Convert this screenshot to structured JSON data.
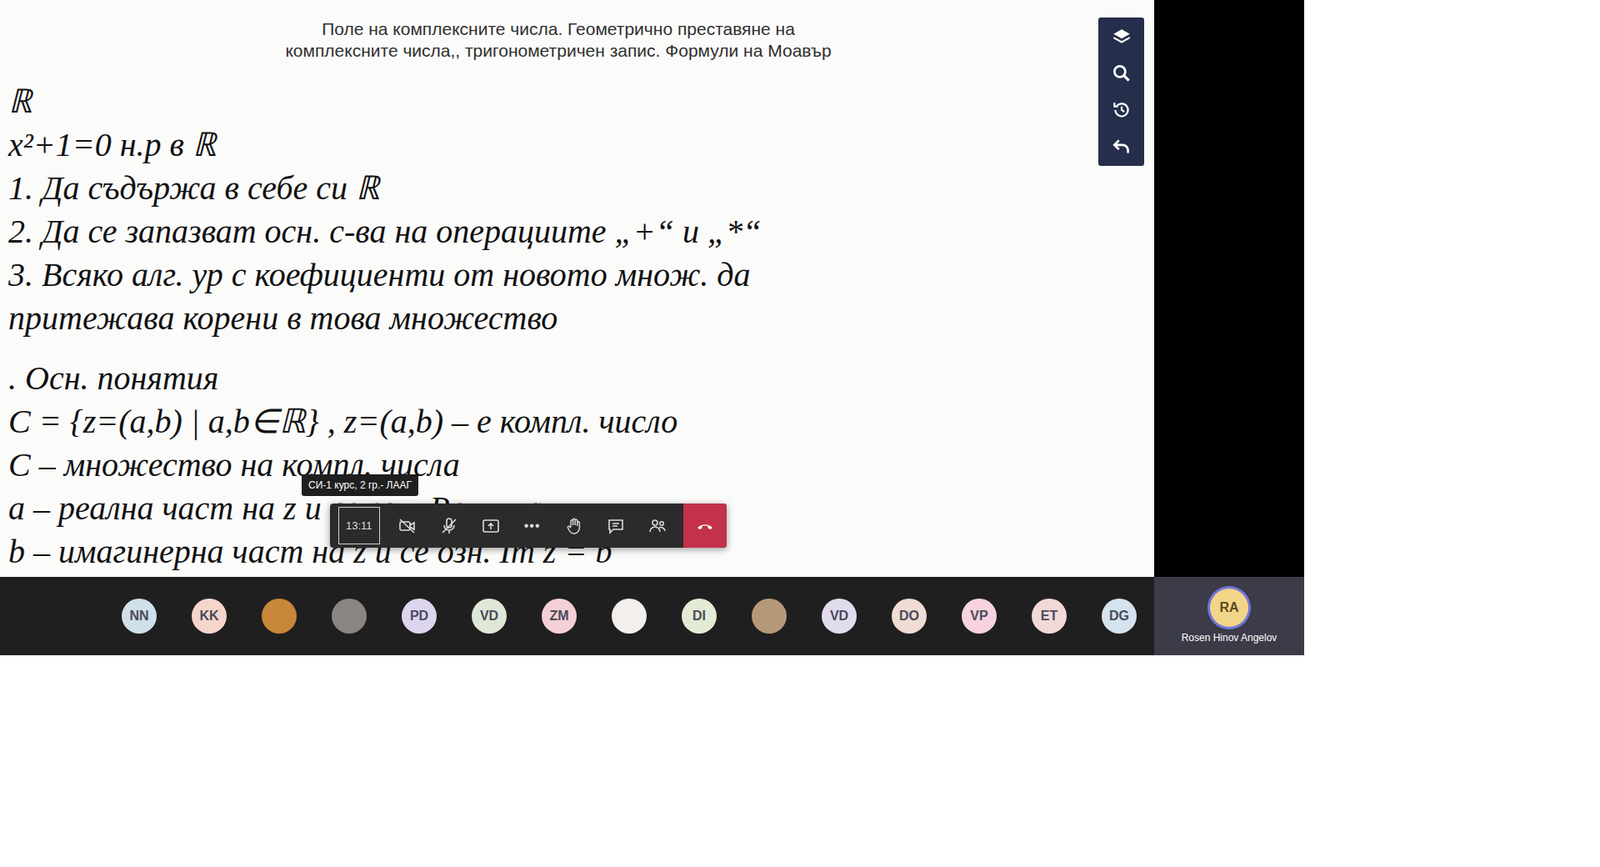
{
  "whiteboard": {
    "title": [
      "Поле на комплексните числа. Геометрично преставяне на",
      "комплексните числа,, тригонометричен запис. Формули на Моавър"
    ],
    "intro_lines": [
      "ℝ",
      "x²+1=0 н.р в ℝ",
      "1. Да съдържа в себе си ℝ",
      "2. Да се запазват осн. с-ва на операциите „+“ и „*“",
      "3. Всяко алг. ур с коефициенти от новото множ. да",
      "притежава корени в това множество"
    ],
    "section_lines": [
      ". Осн. понятия",
      "C = {z=(a,b) | a,b∈ℝ} , z=(a,b) – е компл. число",
      "C – множество на компл. числа",
      "a – реална част на z и се озн. Re z = a",
      "b – имагинерна част на z и се озн. Im z = b"
    ]
  },
  "tooltip": "СИ-1 курс, 2 гр.- ЛААГ",
  "call_controls": {
    "timer": "13:11",
    "camera_on": false,
    "mic_on": false,
    "more": "•••"
  },
  "participants": [
    {
      "initials": "NN",
      "kind": "initials",
      "color": "#cfe0ea"
    },
    {
      "initials": "KK",
      "kind": "initials",
      "color": "#f5d5cc"
    },
    {
      "initials": "",
      "kind": "photo",
      "color": "#c8873a"
    },
    {
      "initials": "",
      "kind": "photo",
      "color": "#8a8580"
    },
    {
      "initials": "PD",
      "kind": "initials",
      "color": "#ddd5ee"
    },
    {
      "initials": "VD",
      "kind": "initials",
      "color": "#dfe7d6"
    },
    {
      "initials": "ZM",
      "kind": "initials",
      "color": "#f4d0d6"
    },
    {
      "initials": "",
      "kind": "photo",
      "color": "#f2efec"
    },
    {
      "initials": "DI",
      "kind": "initials",
      "color": "#e3ebd5"
    },
    {
      "initials": "",
      "kind": "photo",
      "color": "#b59a7a"
    },
    {
      "initials": "VD",
      "kind": "initials",
      "color": "#e0dcee"
    },
    {
      "initials": "DO",
      "kind": "initials",
      "color": "#efdcd3"
    },
    {
      "initials": "VP",
      "kind": "initials",
      "color": "#f6d3de"
    },
    {
      "initials": "ET",
      "kind": "initials",
      "color": "#f0d9d6"
    },
    {
      "initials": "DG",
      "kind": "initials",
      "color": "#d4e3ee"
    }
  ],
  "presenter": {
    "initials": "RA",
    "name": "Rosen Hinov Angelov",
    "color": "#f3d58a",
    "speaking": true
  }
}
